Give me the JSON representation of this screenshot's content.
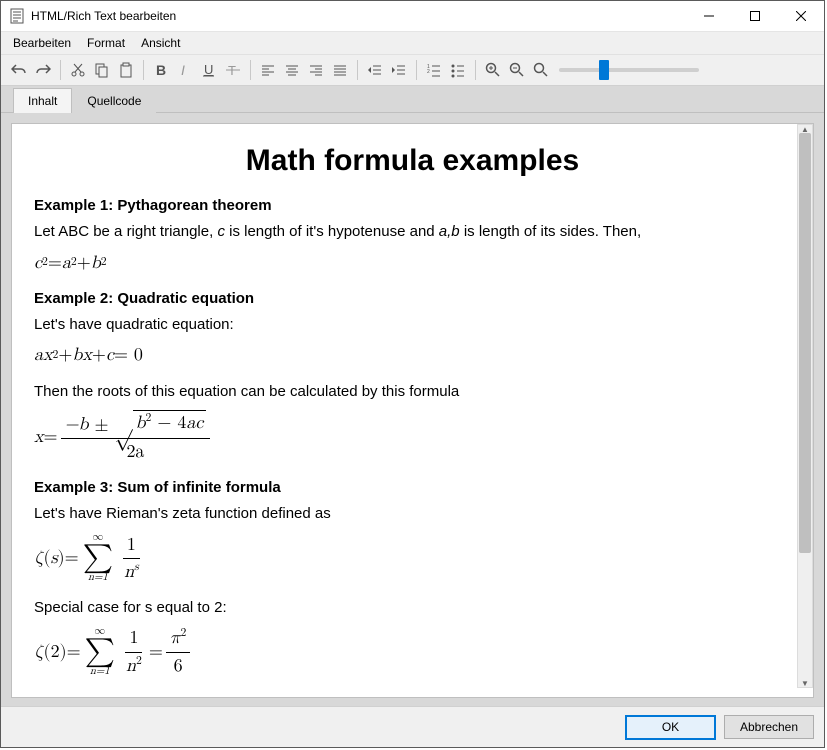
{
  "window": {
    "title": "HTML/Rich Text bearbeiten"
  },
  "menu": {
    "edit": "Bearbeiten",
    "format": "Format",
    "view": "Ansicht"
  },
  "tabs": {
    "content": "Inhalt",
    "source": "Quellcode"
  },
  "footer": {
    "ok": "OK",
    "cancel": "Abbrechen"
  },
  "doc": {
    "title": "Math formula examples",
    "ex1_h": "Example 1: Pythagorean theorem",
    "ex1_t1": "Let ABC be a right triangle, ",
    "ex1_c": "c",
    "ex1_t2": " is length of it's hypotenuse and ",
    "ex1_ab": "a,b",
    "ex1_t3": " is length of its sides. Then,",
    "f1_lhs": "c",
    "f1_eq": " = ",
    "f1_a": "a",
    "f1_p": " + ",
    "f1_b": "b",
    "f1_sq": "2",
    "ex2_h": "Example 2: Quadratic equation",
    "ex2_t": "Let's have quadratic equation:",
    "f2_a": "a",
    "f2_x1": "x",
    "f2_p1": " + ",
    "f2_b": "b",
    "f2_x2": "x",
    "f2_p2": " + ",
    "f2_c": "c",
    "f2_eq": " = 0",
    "ex2_t2": "Then the roots of this equation can be calculated by this formula",
    "f3_x": "x",
    "f3_eq": " = ",
    "f3_num_mb": "−b",
    "f3_num_pm": " ± ",
    "f3_rad_b": "b",
    "f3_rad_m": " − 4",
    "f3_rad_a": "a",
    "f3_rad_c": "c",
    "f3_den_2a": "2a",
    "ex3_h": "Example 3: Sum of infinite formula",
    "ex3_t": "Let's have Rieman's zeta function defined as",
    "f4_z": "ζ",
    "f4_s": "s",
    "f4_eq": " = ",
    "f4_top": "∞",
    "f4_bot": "n=1",
    "f4_num1": "1",
    "f4_den_n": "n",
    "f4_den_s": "s",
    "ex3_t2": "Special case for s equal to 2:",
    "f5_z": "ζ",
    "f5_2": "2",
    "f5_eq": " = ",
    "f5_top": "∞",
    "f5_bot": "n=1",
    "f5_num1": "1",
    "f5_den_n": "n",
    "f5_den_2": "2",
    "f5_eq2": " = ",
    "f5_pi": "π",
    "f5_pi2": "2",
    "f5_den6": "6"
  },
  "icons": {
    "undo": "undo-icon",
    "redo": "redo-icon",
    "cut": "cut-icon",
    "copy": "copy-icon",
    "paste": "paste-icon",
    "bold": "bold-icon",
    "italic": "italic-icon",
    "underline": "underline-icon",
    "strike": "strike-icon",
    "alignl": "align-left-icon",
    "alignc": "align-center-icon",
    "alignr": "align-right-icon",
    "alignj": "align-justify-icon",
    "outdent": "outdent-icon",
    "indent": "indent-icon",
    "ol": "ordered-list-icon",
    "ul": "unordered-list-icon",
    "zoomin": "zoom-in-icon",
    "zoomout": "zoom-out-icon",
    "zoom": "zoom-icon"
  }
}
